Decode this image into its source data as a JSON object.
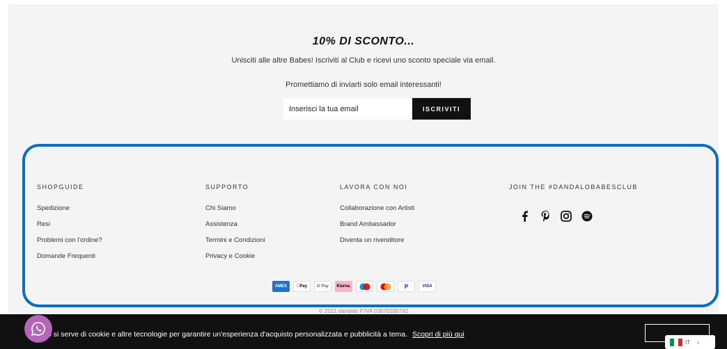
{
  "newsletter": {
    "title": "10% DI SCONTO...",
    "subtitle": "Unisciti alle altre Babes! Iscriviti al Club e ricevi uno sconto speciale via email.",
    "promise": "Promettiamo di inviarti solo email interessanti!",
    "email_placeholder": "Inserisci la tua email",
    "subscribe_label": "ISCRIVITI"
  },
  "footer": {
    "shopguide": {
      "heading": "SHOPGUIDE",
      "links": [
        "Spedizione",
        "Resi",
        "Problemi con l'ordine?",
        "Domande Frequenti"
      ]
    },
    "supporto": {
      "heading": "SUPPORTO",
      "links": [
        "Chi Siamo",
        "Assistenza",
        "Termini e Condizioni",
        "Privacy e Cookie"
      ]
    },
    "lavora": {
      "heading": "LAVORA CON NOI",
      "links": [
        "Collaborazione con Artisti",
        "Brand Ambassador",
        "Diventa un rivenditore"
      ]
    },
    "join": {
      "heading": "JOIN THE #DANDALOBABESCLUB",
      "icons": [
        "facebook-icon",
        "pinterest-icon",
        "instagram-icon",
        "spotify-icon"
      ]
    },
    "payments": [
      {
        "name": "amex",
        "label": "AMEX",
        "color": "#1f72cd"
      },
      {
        "name": "apple-pay",
        "label": "Pay",
        "color": "#000000"
      },
      {
        "name": "google-pay",
        "label": "G Pay",
        "color": "#5f6368"
      },
      {
        "name": "klarna",
        "label": "Klarna.",
        "color": "#ffb3c7"
      },
      {
        "name": "maestro",
        "label": "",
        "color": "#0099df"
      },
      {
        "name": "mastercard",
        "label": "",
        "color": "#eb001b"
      },
      {
        "name": "paypal",
        "label": "P",
        "color": "#003087"
      },
      {
        "name": "visa",
        "label": "VISA",
        "color": "#1a1f71"
      }
    ],
    "copyright": "© 2021 dandalo P.IVA 03070330792"
  },
  "cookie": {
    "text": "o si serve di cookie e altre tecnologie per garantire un'esperienza d'acquisto personalizzata e pubblicità a tema.",
    "link": "Scopri di più qui"
  },
  "language": {
    "code": "IT"
  },
  "colors": {
    "highlight": "#0a6fc1",
    "whatsapp": "#b566b8",
    "background": "#f4f4f4"
  }
}
